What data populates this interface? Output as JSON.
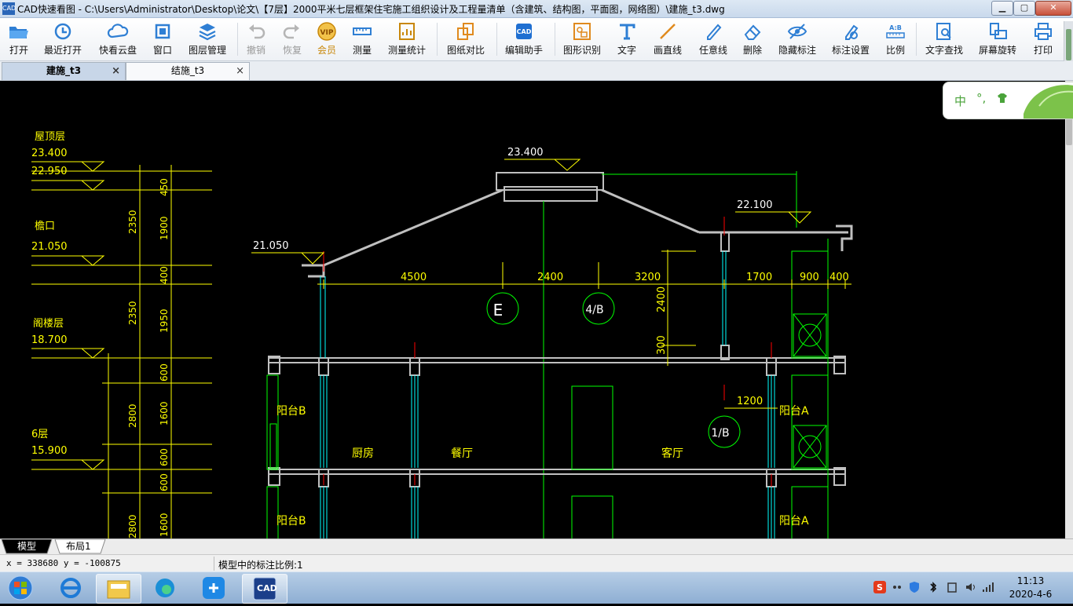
{
  "window": {
    "icon_text": "CAD",
    "title": "CAD快速看图 - C:\\Users\\Administrator\\Desktop\\论文\\【7层】2000平米七层框架住宅施工组织设计及工程量清单（含建筑、结构图，平面图，网络图）\\建施_t3.dwg",
    "minimize": "▁",
    "maximize": "▢",
    "close": "✕"
  },
  "toolbar": [
    {
      "id": "open",
      "label": "打开",
      "icon": "folder-open-icon",
      "enabled": true
    },
    {
      "id": "recent",
      "label": "最近打开",
      "icon": "clock-history-icon",
      "enabled": true
    },
    {
      "id": "cloud",
      "label": "快看云盘",
      "icon": "cloud-icon",
      "enabled": true
    },
    {
      "id": "window",
      "label": "窗口",
      "icon": "window-frame-icon",
      "enabled": true
    },
    {
      "id": "layers",
      "label": "图层管理",
      "icon": "layers-icon",
      "enabled": true
    },
    {
      "id": "undo",
      "label": "撤销",
      "icon": "undo-icon",
      "enabled": false
    },
    {
      "id": "redo",
      "label": "恢复",
      "icon": "redo-icon",
      "enabled": false
    },
    {
      "id": "vip",
      "label": "会员",
      "icon": "vip-badge-icon",
      "enabled": true
    },
    {
      "id": "measure",
      "label": "测量",
      "icon": "ruler-icon",
      "enabled": true
    },
    {
      "id": "measure_stats",
      "label": "测量统计",
      "icon": "measure-stats-icon",
      "enabled": true
    },
    {
      "id": "compare",
      "label": "图纸对比",
      "icon": "compare-sheets-icon",
      "enabled": true
    },
    {
      "id": "edit_helper",
      "label": "编辑助手",
      "icon": "cad-edit-icon",
      "enabled": true
    },
    {
      "id": "shape_recog",
      "label": "图形识别",
      "icon": "shape-recognition-icon",
      "enabled": true
    },
    {
      "id": "text",
      "label": "文字",
      "icon": "text-t-icon",
      "enabled": true
    },
    {
      "id": "line",
      "label": "画直线",
      "icon": "line-icon",
      "enabled": true
    },
    {
      "id": "freeline",
      "label": "任意线",
      "icon": "pen-icon",
      "enabled": true
    },
    {
      "id": "erase",
      "label": "删除",
      "icon": "eraser-icon",
      "enabled": true
    },
    {
      "id": "hide_marks",
      "label": "隐藏标注",
      "icon": "eye-hidden-icon",
      "enabled": true
    },
    {
      "id": "mark_settings",
      "label": "标注设置",
      "icon": "settings-marker-icon",
      "enabled": true
    },
    {
      "id": "scale",
      "label": "比例",
      "icon": "scale-ab-icon",
      "enabled": true
    },
    {
      "id": "text_search",
      "label": "文字查找",
      "icon": "text-search-icon",
      "enabled": true
    },
    {
      "id": "rotate",
      "label": "屏幕旋转",
      "icon": "screen-rotate-icon",
      "enabled": true
    },
    {
      "id": "print",
      "label": "打印",
      "icon": "printer-icon",
      "enabled": true
    }
  ],
  "tabs": [
    {
      "label": "建施_t3",
      "active": true,
      "close": "×"
    },
    {
      "label": "结施_t3",
      "active": false,
      "close": "×"
    }
  ],
  "ime": {
    "lang": "中",
    "punct": "°,"
  },
  "drawing": {
    "left_levels": [
      {
        "name": "屋顶层",
        "elev1": "23.400",
        "elev2": "22.950"
      },
      {
        "name": "檐口",
        "elev1": "21.050"
      },
      {
        "name": "阁楼层",
        "elev1": "18.700"
      },
      {
        "name": "6层",
        "elev1": "15.900"
      }
    ],
    "left_dims_outer": [
      "2350",
      "2350",
      "2800",
      "2800"
    ],
    "left_dims_inner": [
      "450",
      "1900",
      "400",
      "1950",
      "600",
      "1600",
      "600",
      "600",
      "1600"
    ],
    "top_elev": "23.400",
    "right_elev": "22.100",
    "eave_elev": "21.050",
    "horiz_dims": [
      "4500",
      "2400",
      "3200",
      "1700",
      "900",
      "400"
    ],
    "vert_dims": [
      "2400",
      "300"
    ],
    "dim_1200": "1200",
    "axes": [
      "E",
      "4/B",
      "1/B"
    ],
    "rooms": [
      "阳台B",
      "厨房",
      "餐厅",
      "客厅",
      "阳台A",
      "阳台B",
      "阳台A"
    ]
  },
  "layout_tabs": [
    {
      "label": "模型",
      "active": true
    },
    {
      "label": "布局1",
      "active": false
    }
  ],
  "status": {
    "coords": "x = 338680  y = -100875",
    "scale_text": "模型中的标注比例:1"
  },
  "taskbar": {
    "time": "11:13",
    "date": "2020-4-6",
    "cad_label": "CAD"
  },
  "colors": {
    "canvas_bg": "#000000",
    "cad_yellow": "#ffff00",
    "cad_green": "#00ff00",
    "cad_white": "#ffffff",
    "cad_red": "#ff0000",
    "cad_cyan": "#00ffff",
    "wall_gray": "#c0c0c0",
    "vip_gold": "#c8870a"
  }
}
